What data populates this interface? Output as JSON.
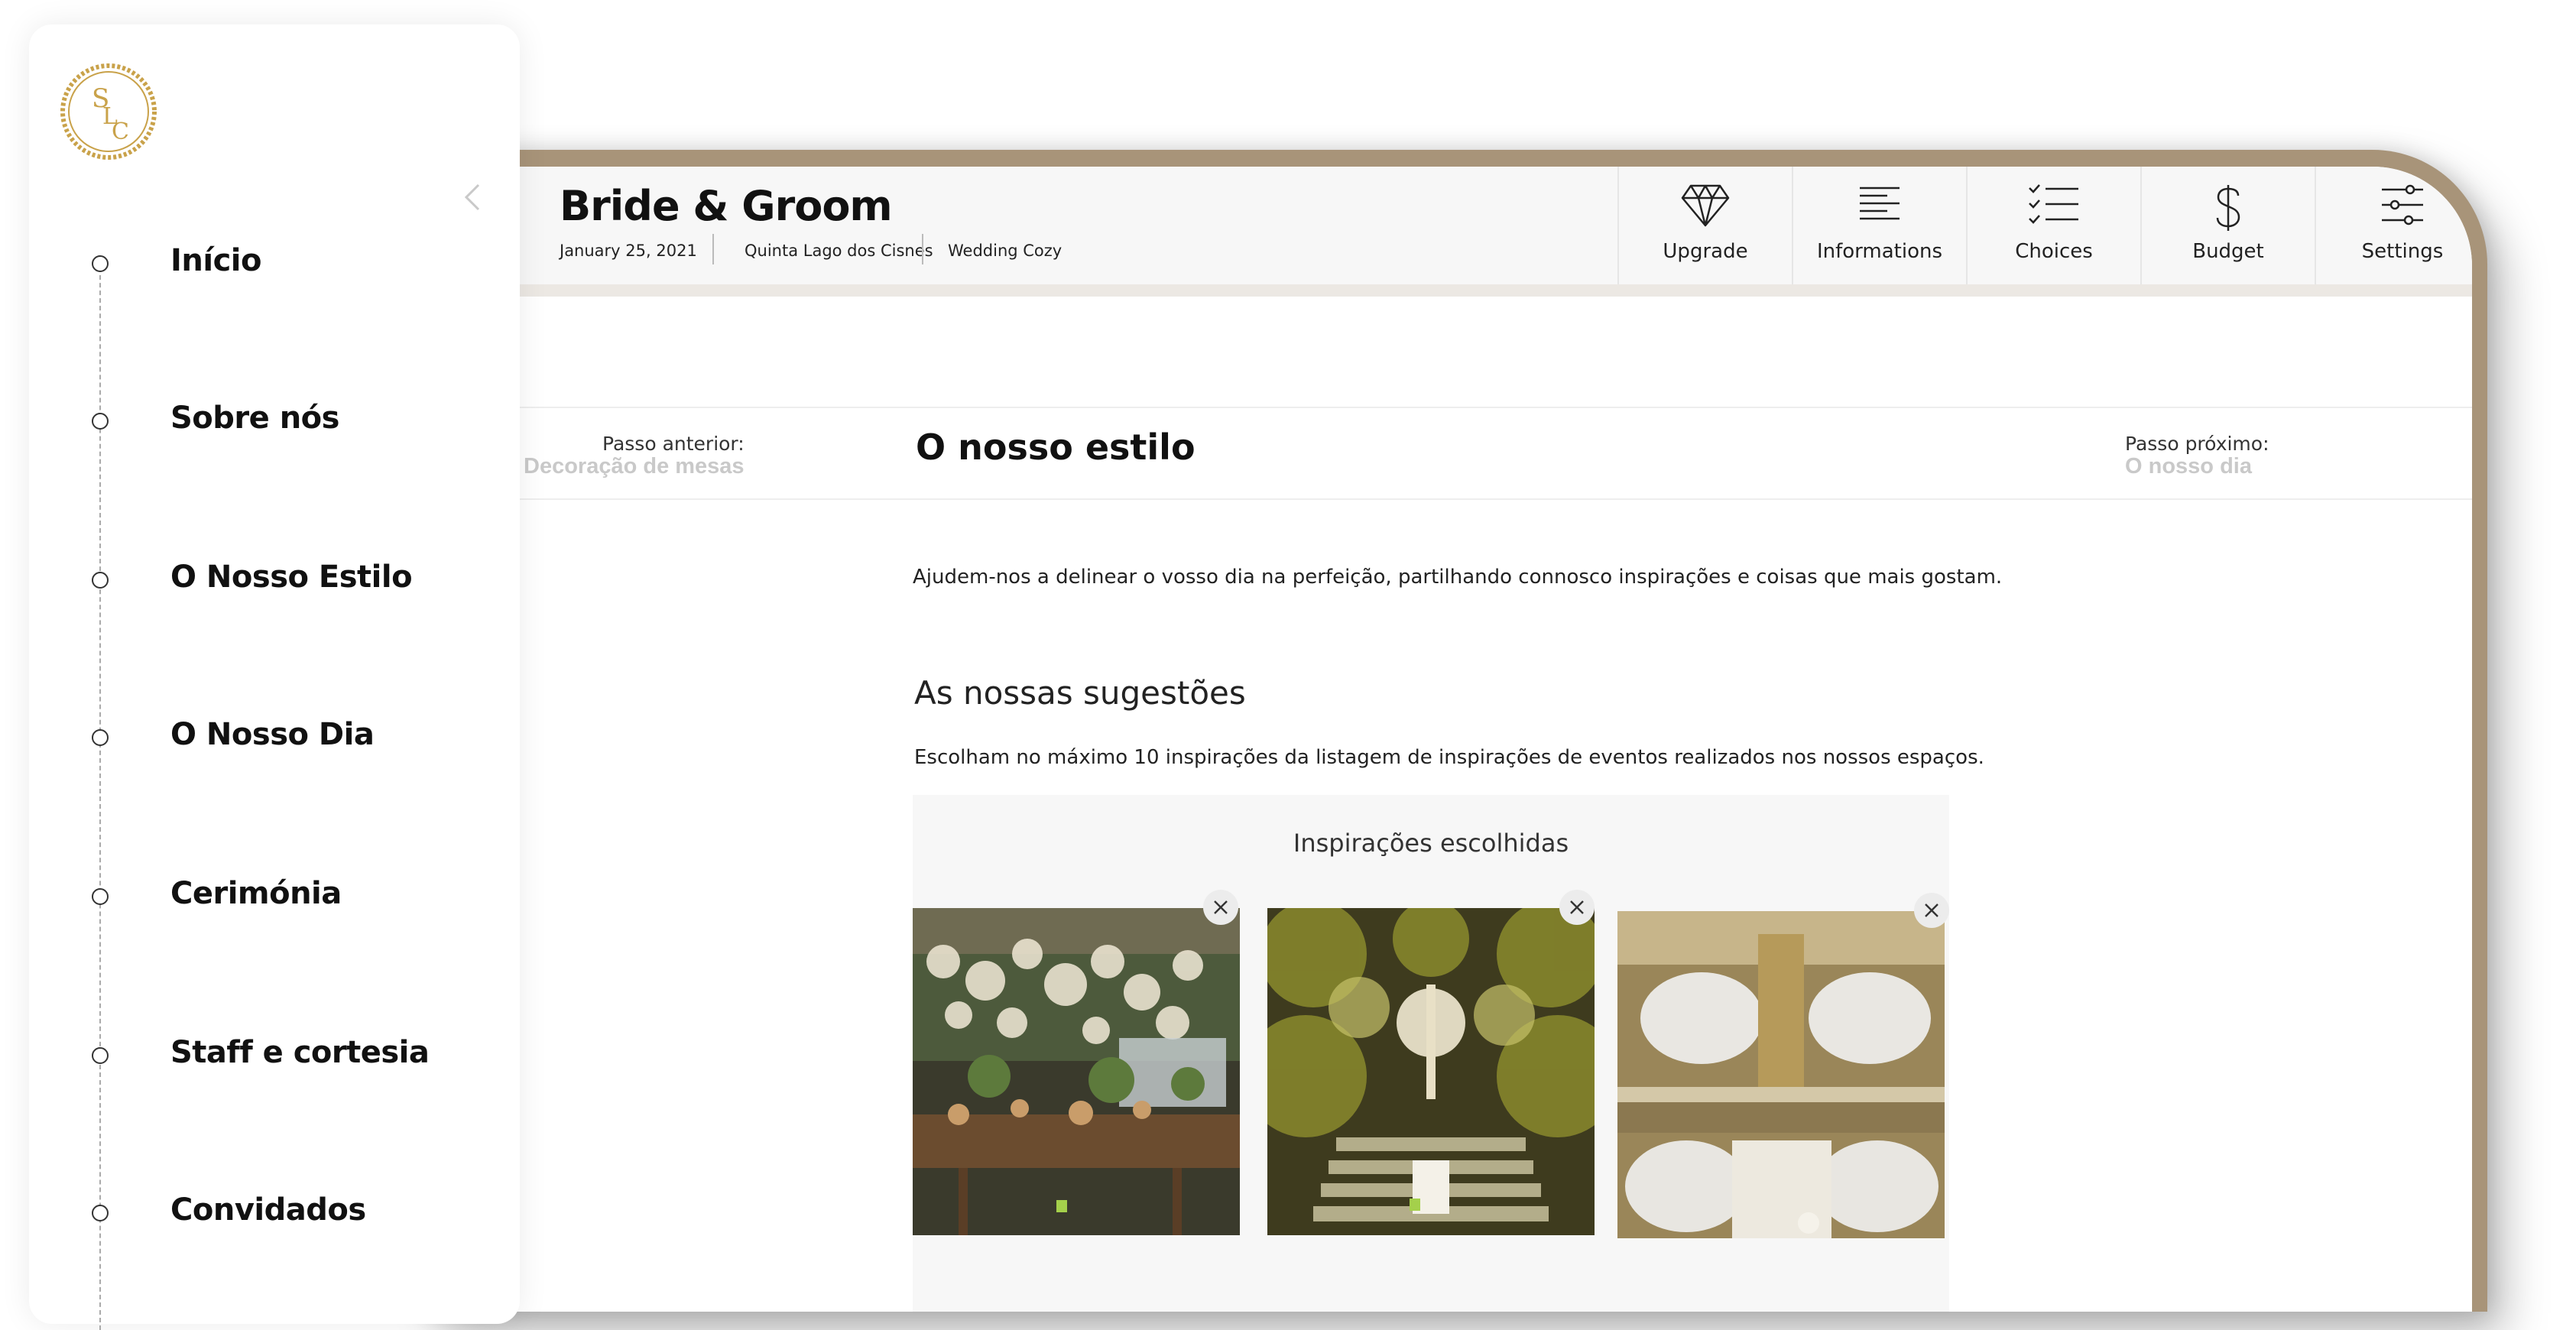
{
  "header": {
    "title": "Bride & Groom",
    "date": "January 25, 2021",
    "venue": "Quinta Lago dos Cisnes",
    "package": "Wedding Cozy",
    "nav": [
      {
        "label": "Upgrade",
        "icon": "diamond-icon"
      },
      {
        "label": "Informations",
        "icon": "text-lines-icon"
      },
      {
        "label": "Choices",
        "icon": "checklist-icon"
      },
      {
        "label": "Budget",
        "icon": "dollar-icon"
      },
      {
        "label": "Settings",
        "icon": "sliders-icon"
      }
    ]
  },
  "step": {
    "prev_label": "Passo anterior:",
    "prev_value": "Decoração de mesas",
    "title": "O nosso estilo",
    "next_label": "Passo próximo:",
    "next_value": "O nosso dia"
  },
  "content": {
    "intro": "Ajudem-nos a delinear o vosso dia na perfeição, partilhando connosco inspirações e coisas que mais gostam.",
    "suggestions_title": "As nossas sugestões",
    "suggestions_sub": "Escolham no máximo 10 inspirações da listagem de inspirações de eventos realizados nos nossos espaços.",
    "chosen_title": "Inspirações escolhidas",
    "photos": [
      "decor-lanterns-photo",
      "staircase-chandelier-photo",
      "wedding-cake-photo"
    ]
  },
  "sidebar": {
    "logo_text": "SLC",
    "items": [
      {
        "label": "Início"
      },
      {
        "label": "Sobre nós"
      },
      {
        "label": "O Nosso Estilo"
      },
      {
        "label": "O Nosso Dia"
      },
      {
        "label": "Cerimónia"
      },
      {
        "label": "Staff e cortesia"
      },
      {
        "label": "Convidados"
      }
    ]
  },
  "colors": {
    "frame": "#a89479",
    "logo_gold": "#c9a24a",
    "muted": "#c9c9c9"
  }
}
